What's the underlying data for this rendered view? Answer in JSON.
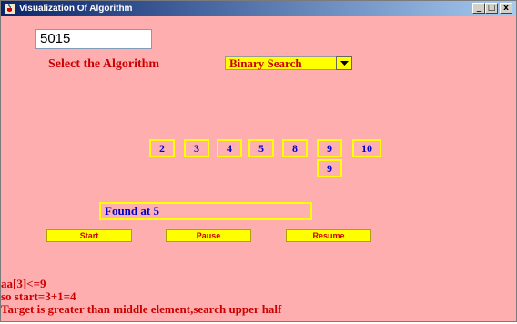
{
  "window": {
    "title": "Visualization Of Algorithm",
    "controls": {
      "minimize": "_",
      "maximize": "□",
      "close": "x"
    }
  },
  "input": {
    "value": "5015"
  },
  "algorithm": {
    "label": "Select the Algorithm",
    "selected": "Binary Search"
  },
  "array_cells": [
    {
      "value": "2"
    },
    {
      "value": "3"
    },
    {
      "value": "4"
    },
    {
      "value": "5"
    },
    {
      "value": "8"
    },
    {
      "value": "9"
    },
    {
      "value": "10"
    }
  ],
  "search_cell": {
    "value": "9"
  },
  "status": "Found at 5",
  "buttons": {
    "start": "Start",
    "pause": "Pause",
    "resume": "Resume"
  },
  "log": [
    "aa[3]<=9",
    "so start=3+1=4",
    "Target is greater than middle element,search upper half"
  ],
  "colors": {
    "background": "#ffaeb0",
    "highlight": "#ffff00",
    "label_red": "#cc0000",
    "value_blue": "#0000cc"
  }
}
